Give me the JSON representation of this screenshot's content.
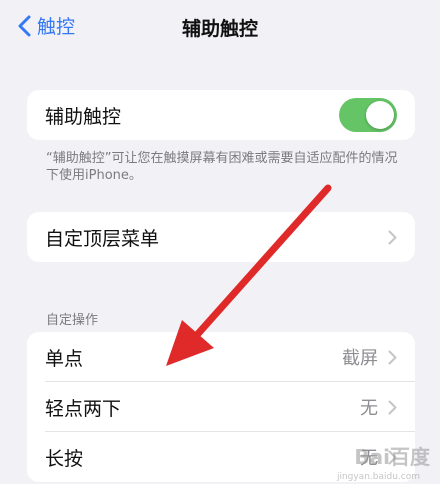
{
  "nav": {
    "back_label": "触控",
    "title": "辅助触控"
  },
  "toggle_card": {
    "label": "辅助触控",
    "enabled": true
  },
  "footnote": "“辅助触控”可让您在触摸屏幕有困难或需要自适应配件的情况下使用iPhone。",
  "menu_card": {
    "label": "自定顶层菜单"
  },
  "section_header": "自定操作",
  "actions": [
    {
      "label": "单点",
      "value": "截屏"
    },
    {
      "label": "轻点两下",
      "value": "无"
    },
    {
      "label": "长按",
      "value": "无"
    }
  ],
  "overlay": {
    "watermark": "Bai百度",
    "watermark_sub": "jingyan.baidu.com",
    "arrow_color": "#e02a2a"
  },
  "colors": {
    "accent": "#3478f6",
    "toggle_on": "#65c466",
    "background": "#f2f2f6"
  }
}
